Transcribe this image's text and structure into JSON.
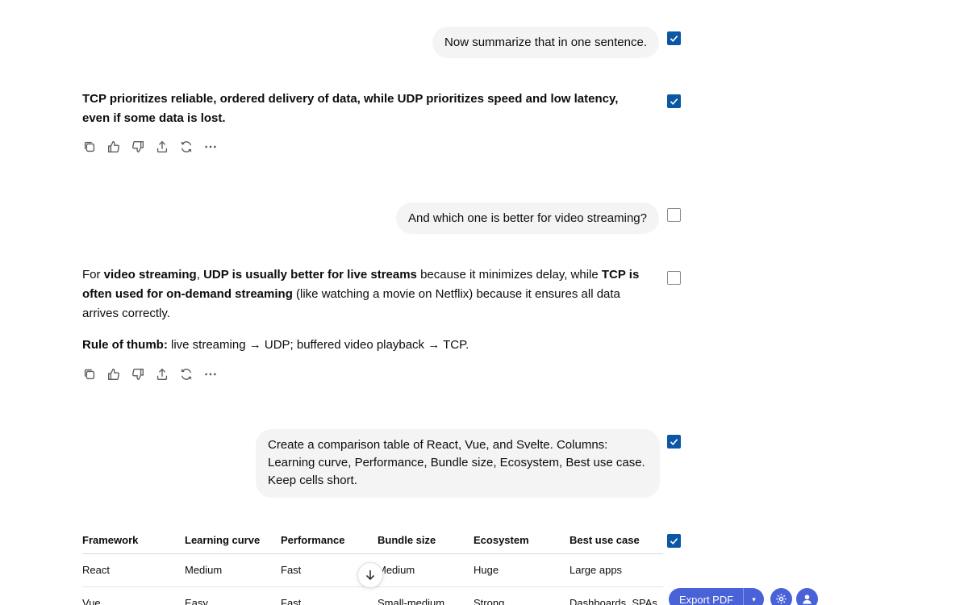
{
  "messages": {
    "m1": {
      "text": "Now summarize that in one sentence.",
      "selected": true
    },
    "m2": {
      "text": "TCP prioritizes reliable, ordered delivery of data, while UDP prioritizes speed and low latency, even if some data is lost.",
      "selected": true
    },
    "m3": {
      "text": "And which one is better for video streaming?",
      "selected": false
    },
    "m4": {
      "p1": {
        "t1": "For ",
        "b1": "video streaming",
        "t2": ", ",
        "b2": "UDP is usually better for live streams",
        "t3": " because it minimizes delay, while ",
        "b3": "TCP is often used for on-demand streaming",
        "t4": " (like watching a movie on Netflix) because it ensures all data arrives correctly."
      },
      "p2": {
        "b1": "Rule of thumb:",
        "t1": " live streaming → UDP; buffered video playback → TCP."
      },
      "selected": false
    },
    "m5": {
      "text": "Create a comparison table of React, Vue, and Svelte. Columns: Learning curve, Performance, Bundle size, Ecosystem, Best use case. Keep cells short.",
      "selected": true
    },
    "m6": {
      "selected": true
    }
  },
  "action_icons": [
    "copy-icon",
    "thumbs-up-icon",
    "thumbs-down-icon",
    "share-icon",
    "regenerate-icon",
    "more-icon"
  ],
  "table": {
    "headers": [
      "Framework",
      "Learning curve",
      "Performance",
      "Bundle size",
      "Ecosystem",
      "Best use case"
    ],
    "rows": [
      [
        "React",
        "Medium",
        "Fast",
        "Medium",
        "Huge",
        "Large apps"
      ],
      [
        "Vue",
        "Easy",
        "Fast",
        "Small-medium",
        "Strong",
        "Dashboards, SPAs"
      ]
    ]
  },
  "toolbar": {
    "export_label": "Export PDF",
    "caret": "▾",
    "accent": "#4a62d8"
  },
  "colors": {
    "checkbox_checked": "#0b57a4",
    "bubble_bg": "#f4f4f4"
  }
}
